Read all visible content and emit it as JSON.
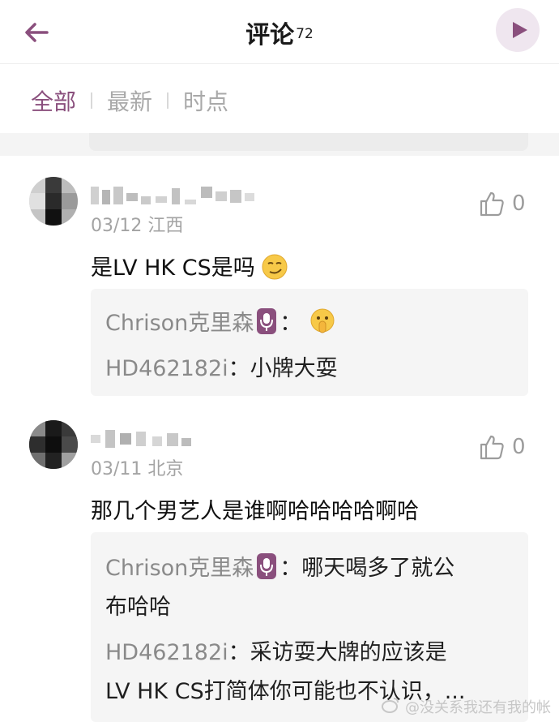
{
  "header": {
    "title": "评论",
    "count": "72"
  },
  "tabs": [
    {
      "label": "全部",
      "active": true
    },
    {
      "label": "最新",
      "active": false
    },
    {
      "label": "时点",
      "active": false
    }
  ],
  "comments": [
    {
      "meta": "03/12 江西",
      "likes": "0",
      "text": "是LV HK CS是吗",
      "replies": [
        {
          "name": "Chrison克里森",
          "sep": "：",
          "text": ""
        },
        {
          "name": "HD462182i",
          "sep": "：",
          "text": "小牌大耍"
        }
      ]
    },
    {
      "meta": "03/11 北京",
      "likes": "0",
      "text": "那几个男艺人是谁啊哈哈哈哈啊哈",
      "replies": [
        {
          "name": "Chrison克里森",
          "sep": "：",
          "text": "哪天喝多了就公",
          "cont": "布哈哈"
        },
        {
          "name": "HD462182i",
          "sep": "：",
          "text": "采访耍大牌的应该是",
          "cont": "LV HK CS打简体你可能也不认识，..."
        }
      ]
    }
  ],
  "watermark": "@没关系我还有我的帐",
  "colors": {
    "accent": "#8a4f7d",
    "muted": "#a3a3a3"
  }
}
